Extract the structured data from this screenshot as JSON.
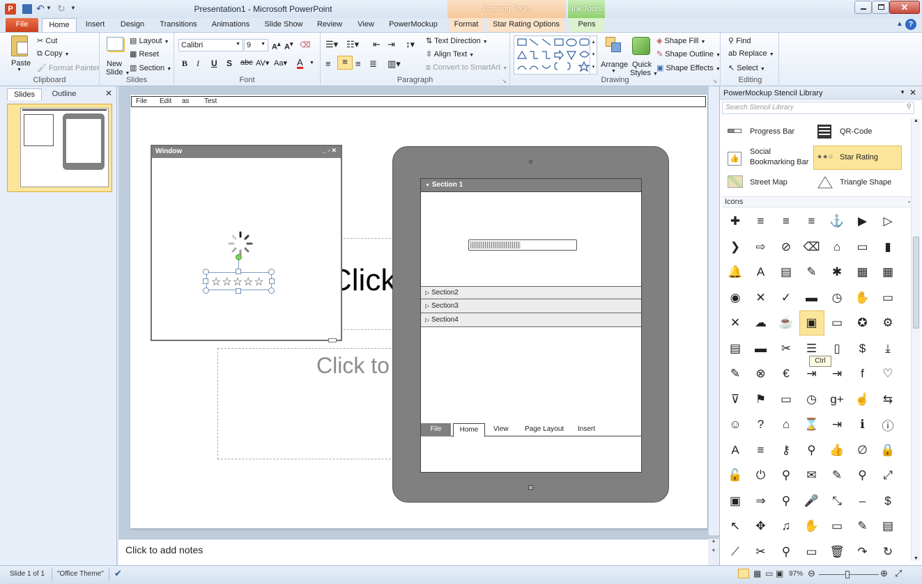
{
  "window": {
    "title": "Presentation1 - Microsoft PowerPoint"
  },
  "contextual": {
    "drawing_tools": "Drawing Tools",
    "ink_tools": "Ink Tools"
  },
  "tabs": {
    "file": "File",
    "home": "Home",
    "insert": "Insert",
    "design": "Design",
    "transitions": "Transitions",
    "animations": "Animations",
    "slide_show": "Slide Show",
    "review": "Review",
    "view": "View",
    "powermockup": "PowerMockup",
    "format": "Format",
    "star_rating_options": "Star Rating Options",
    "pens": "Pens"
  },
  "clipboard": {
    "paste": "Paste",
    "cut": "Cut",
    "copy": "Copy",
    "format_painter": "Format Painter",
    "label": "Clipboard"
  },
  "slides_grp": {
    "new_slide_1": "New",
    "new_slide_2": "Slide",
    "layout": "Layout",
    "reset": "Reset",
    "section": "Section",
    "label": "Slides"
  },
  "font": {
    "name": "Calibri",
    "size": "9",
    "label": "Font"
  },
  "paragraph": {
    "text_direction": "Text Direction",
    "align_text": "Align Text",
    "convert_smartart": "Convert to SmartArt",
    "label": "Paragraph"
  },
  "drawing": {
    "arrange": "Arrange",
    "quick_styles_1": "Quick",
    "quick_styles_2": "Styles",
    "shape_fill": "Shape Fill",
    "shape_outline": "Shape Outline",
    "shape_effects": "Shape Effects",
    "label": "Drawing"
  },
  "editing": {
    "find": "Find",
    "replace": "Replace",
    "select": "Select",
    "label": "Editing"
  },
  "panel_tabs": {
    "slides": "Slides",
    "outline": "Outline",
    "thumb_number": "1"
  },
  "slide": {
    "menubar": [
      "File",
      "Edit",
      "as",
      "Test"
    ],
    "window_title": "Window",
    "title_placeholder": "Click to",
    "subtitle_placeholder": "Click to",
    "stars": "☆☆☆☆☆",
    "tablet_section1": "Section 1",
    "tablet_sections": [
      "Section2",
      "Section3",
      "Section4"
    ],
    "tablet_tabs": {
      "file": "File",
      "home": "Home",
      "view": "View",
      "page_layout": "Page Layout",
      "insert": "Insert"
    },
    "progress_fraction": 0.48
  },
  "notes": {
    "placeholder": "Click to add notes"
  },
  "stencil": {
    "title": "PowerMockup Stencil Library",
    "search_placeholder": "Search Stencil Library",
    "items": {
      "progress_bar": "Progress Bar",
      "qr_code": "QR-Code",
      "social_1": "Social",
      "social_2": "Bookmarking Bar",
      "star_rating": "Star Rating",
      "street_map": "Street Map",
      "triangle_shape": "Triangle Shape"
    },
    "icons_header": "Icons",
    "tooltip": "Ctrl",
    "icon_glyphs": [
      "✚",
      "≡",
      "≡",
      "≡",
      "⚓",
      "▶",
      "▷",
      "❯",
      "⇨",
      "⊘",
      "⌫",
      "⌂",
      "▭",
      "▮",
      "🔔",
      "A",
      "▤",
      "✎",
      "✱",
      "▦",
      "▦",
      "◉",
      "✕",
      "✓",
      "▬",
      "◷",
      "✋",
      "▭",
      "✕",
      "☁",
      "☕",
      "▣",
      "▭",
      "✪",
      "⚙",
      "▤",
      "▬",
      "✂",
      "☰",
      "▯",
      "$",
      "⤓",
      "✎",
      "⊗",
      "€",
      "⇥",
      "⇥",
      "f",
      "♡",
      "⊽",
      "⚑",
      "▭",
      "◷",
      "g+",
      "☝",
      "⇆",
      "☺",
      "?",
      "⌂",
      "⌛",
      "⇥",
      "ℹ",
      "ⓘ",
      "A",
      "≡",
      "⚷",
      "⚲",
      "👍",
      "∅",
      "🔒",
      "🔓",
      "⏻",
      "⚲",
      "✉",
      "✎",
      "⚲",
      "⤢",
      "▣",
      "⇒",
      "⚲",
      "🎤",
      "⤡",
      "–",
      "$",
      "↖",
      "✥",
      "♫",
      "✋",
      "▭",
      "✎",
      "▤",
      "⟋",
      "✂",
      "⚲",
      "▭",
      "🗑",
      "↷",
      "↻"
    ],
    "icon_names": [
      "plus-icon",
      "align-center-icon",
      "align-left-icon",
      "align-right-icon",
      "anchor-icon",
      "play-filled-icon",
      "play-outline-icon",
      "chevron-right-icon",
      "arrow-right-icon",
      "paperclip-icon",
      "backspace-icon",
      "bank-icon",
      "banknote-icon",
      "battery-icon",
      "bell-icon",
      "font-icon",
      "book-icon",
      "brush-icon",
      "bug-icon",
      "calculator-icon",
      "calendar-icon",
      "camera-icon",
      "close-x-icon",
      "checkmark-icon",
      "clapperboard-icon",
      "clock-icon",
      "hand-grab-icon",
      "window-icon",
      "small-x-icon",
      "cloud-icon",
      "coffee-icon",
      "terminal-icon",
      "speech-bubble-icon",
      "compass-icon",
      "gear-icon",
      "documents-icon",
      "credit-card-icon",
      "scissors-icon",
      "database-icon",
      "file-icon",
      "dollar-icon",
      "download-icon",
      "pencil-icon",
      "cancel-circle-icon",
      "euro-icon",
      "exit-icon",
      "file-export-icon",
      "facebook-icon",
      "heart-icon",
      "filter-icon",
      "flag-icon",
      "folder-icon",
      "clock-circle-icon",
      "google-plus-icon",
      "hand-pointer-icon",
      "handshake-icon",
      "smiley-icon",
      "question-icon",
      "home-icon",
      "hourglass-icon",
      "import-icon",
      "info-icon",
      "info-circle-icon",
      "italic-a-icon",
      "list-icon",
      "key-icon",
      "lightbulb-icon",
      "thumbs-up-icon",
      "link-icon",
      "lock-icon",
      "unlock-icon",
      "power-icon",
      "search-icon",
      "mail-icon",
      "tag-icon",
      "map-marker-icon",
      "resize-icon",
      "copy-icon",
      "next-icon",
      "wrench-icon",
      "microphone-icon",
      "shrink-icon",
      "minus-icon",
      "money-bag-icon",
      "pointer-icon",
      "move-icon",
      "music-icon",
      "hand-stop-icon",
      "open-folder-icon",
      "palette-icon",
      "clipboard-icon",
      "pdf-icon",
      "tools-icon",
      "document-search-icon",
      "print-icon",
      "trash-icon",
      "redo-icon",
      "refresh-icon"
    ]
  },
  "status": {
    "slide": "Slide 1 of 1",
    "theme": "\"Office Theme\"",
    "zoom": "97%"
  },
  "colors": {
    "file_tab": "#e2532b",
    "drawing_tools": "#f6c99c",
    "ink_tools": "#a6d98f",
    "selected": "#fbe59a",
    "tablet_gray": "#808080",
    "accent": "#2b5797"
  }
}
